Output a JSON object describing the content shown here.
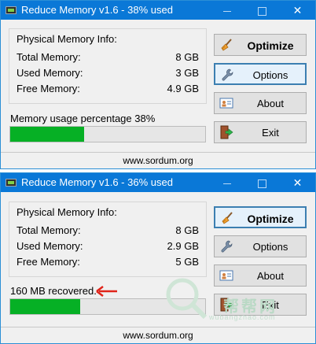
{
  "windows": [
    {
      "title": "Reduce Memory v1.6 - 38% used",
      "panel_title": "Physical Memory Info:",
      "rows": [
        {
          "label": "Total Memory:",
          "value": "8 GB"
        },
        {
          "label": "Used Memory:",
          "value": "3 GB"
        },
        {
          "label": "Free Memory:",
          "value": "4.9 GB"
        }
      ],
      "buttons": {
        "optimize": "Optimize",
        "options": "Options",
        "about": "About",
        "exit": "Exit"
      },
      "status_text": "Memory usage percentage 38%",
      "progress_percent": 38,
      "footer": "www.sordum.org"
    },
    {
      "title": "Reduce Memory v1.6 - 36% used",
      "panel_title": "Physical Memory Info:",
      "rows": [
        {
          "label": "Total Memory:",
          "value": "8 GB"
        },
        {
          "label": "Used Memory:",
          "value": "2.9 GB"
        },
        {
          "label": "Free Memory:",
          "value": "5 GB"
        }
      ],
      "buttons": {
        "optimize": "Optimize",
        "options": "Options",
        "about": "About",
        "exit": "Exit"
      },
      "status_text": "160 MB recovered.",
      "progress_percent": 36,
      "footer": "www.sordum.org"
    }
  ],
  "window_controls": {
    "minimize": "—",
    "maximize": "",
    "close": "✕"
  },
  "colors": {
    "titlebar": "#0a78d7",
    "progress": "#06b025",
    "arrow": "#e0241a"
  },
  "icons": {
    "app": "memory-chip-icon",
    "optimize": "broom-icon",
    "options": "wrench-icon",
    "about": "id-card-icon",
    "exit": "exit-door-icon"
  },
  "watermark": {
    "main": "帮帮网",
    "sub": "wubangzhao.com"
  }
}
